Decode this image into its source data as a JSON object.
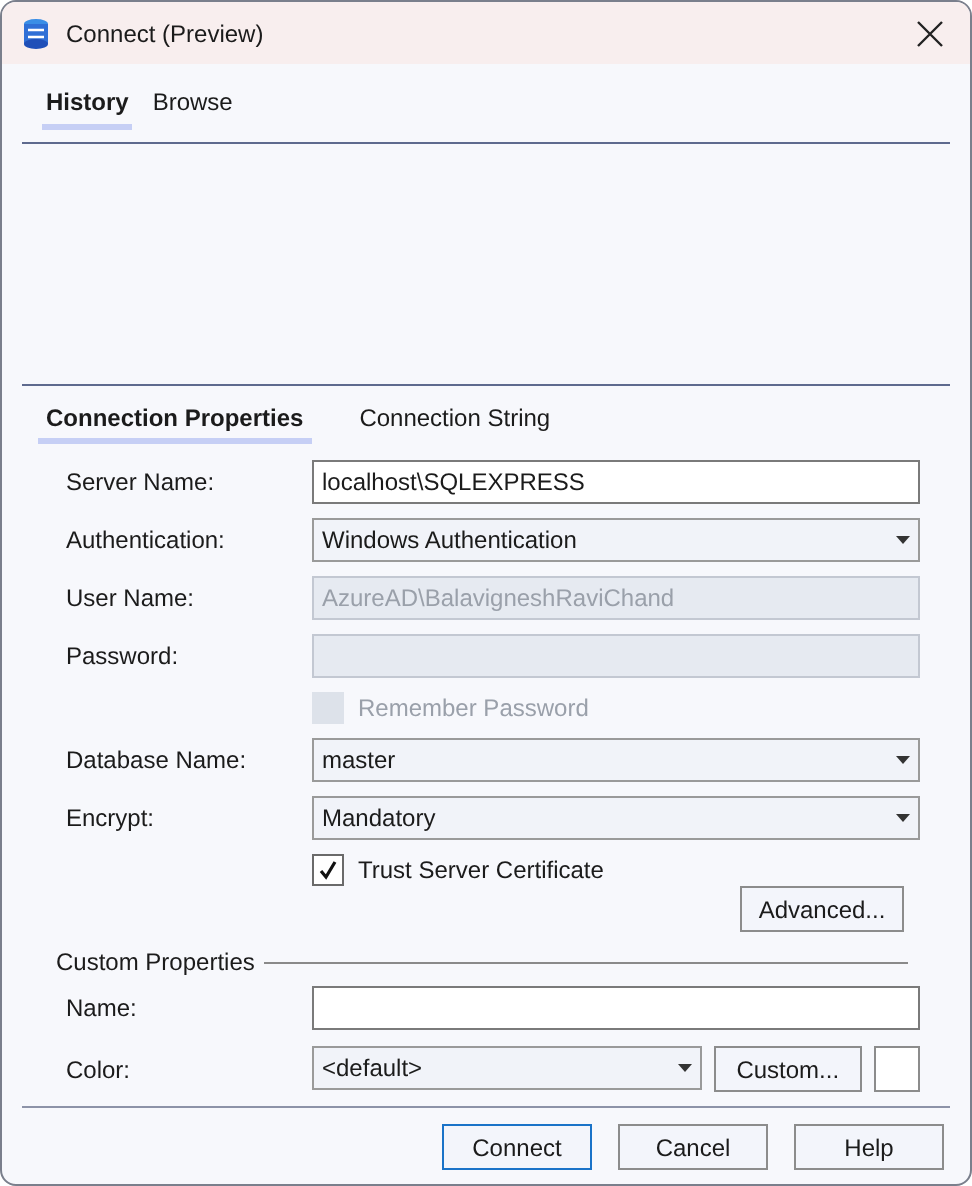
{
  "window": {
    "title": "Connect (Preview)"
  },
  "top_tabs": [
    {
      "label": "History",
      "selected": true
    },
    {
      "label": "Browse",
      "selected": false
    }
  ],
  "property_tabs": [
    {
      "label": "Connection Properties",
      "selected": true
    },
    {
      "label": "Connection String",
      "selected": false
    }
  ],
  "fields": [
    {
      "kind": "text",
      "label": "Server Name:",
      "value": "localhost\\SQLEXPRESS",
      "disabled": false
    },
    {
      "kind": "dropdown",
      "label": "Authentication:",
      "value": "Windows Authentication",
      "disabled": false
    },
    {
      "kind": "text",
      "label": "User Name:",
      "value": "AzureAD\\BalavigneshRaviChand",
      "disabled": true
    },
    {
      "kind": "text",
      "label": "Password:",
      "disabled": true
    },
    {
      "kind": "checkbox",
      "label": "Remember Password",
      "checked": false,
      "disabled": true
    },
    {
      "kind": "dropdown",
      "label": "Database Name:",
      "value": "master",
      "disabled": false
    },
    {
      "kind": "dropdown",
      "label": "Encrypt:",
      "value": "Mandatory",
      "disabled": false
    },
    {
      "kind": "checkbox",
      "label": "Trust Server Certificate",
      "checked": true,
      "disabled": false
    }
  ],
  "advanced_button": "Advanced...",
  "custom_properties": {
    "title": "Custom Properties",
    "name": {
      "label": "Name:"
    },
    "color": {
      "label": "Color:",
      "value": "<default>",
      "button": "Custom..."
    }
  },
  "buttons": [
    {
      "label": "Connect",
      "default": true
    },
    {
      "label": "Cancel",
      "default": false
    },
    {
      "label": "Help",
      "default": false
    }
  ]
}
